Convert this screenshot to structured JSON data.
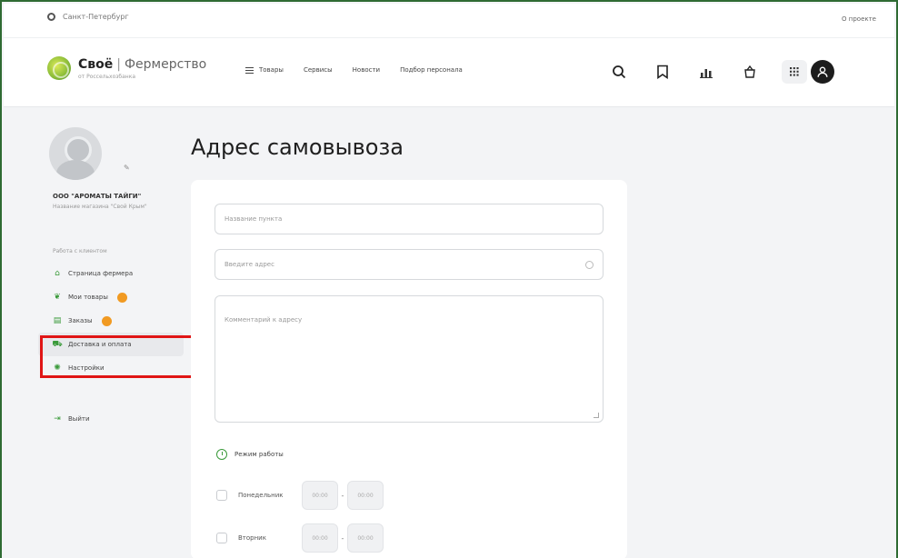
{
  "topbar": {
    "city": "Санкт-Петербург",
    "about": "О проекте"
  },
  "header": {
    "logo_brand": "Своё",
    "logo_separator": "|",
    "logo_product": "Фермерство",
    "logo_sub": "от Россельхозбанка",
    "nav": [
      "Товары",
      "Сервисы",
      "Новости",
      "Подбор персонала"
    ],
    "icons": [
      "search-icon",
      "bookmark-icon",
      "chart-icon",
      "basket-icon",
      "grid-icon",
      "user-icon"
    ]
  },
  "sidebar": {
    "org_name": "ООО \"АРОМАТЫ ТАЙГИ\"",
    "org_sub": "Название магазина \"Свой Крым\"",
    "section_label": "Работа с клиентом",
    "items": [
      {
        "label": "Страница фермера",
        "icon": "home-icon"
      },
      {
        "label": "Мои товары",
        "icon": "sprout-icon"
      },
      {
        "label": "Заказы",
        "icon": "orders-icon"
      },
      {
        "label": "Доставка и оплата",
        "icon": "delivery-icon"
      },
      {
        "label": "Настройки",
        "icon": "settings-icon"
      }
    ],
    "logout": "Выйти"
  },
  "main": {
    "title": "Адрес самовывоза",
    "point_placeholder": "Название пункта",
    "address_placeholder": "Введите адрес",
    "comment_placeholder": "Комментарий к адресу",
    "work_mode_label": "Режим работы",
    "days": [
      {
        "label": "Понедельник",
        "from": "00:00",
        "to": "00:00"
      },
      {
        "label": "Вторник",
        "from": "00:00",
        "to": "00:00"
      }
    ],
    "time_separator": "-"
  },
  "colors": {
    "accent": "#3a9a3a",
    "badge": "#f19a22",
    "highlight": "#e01515",
    "frame": "#2f6b33"
  }
}
